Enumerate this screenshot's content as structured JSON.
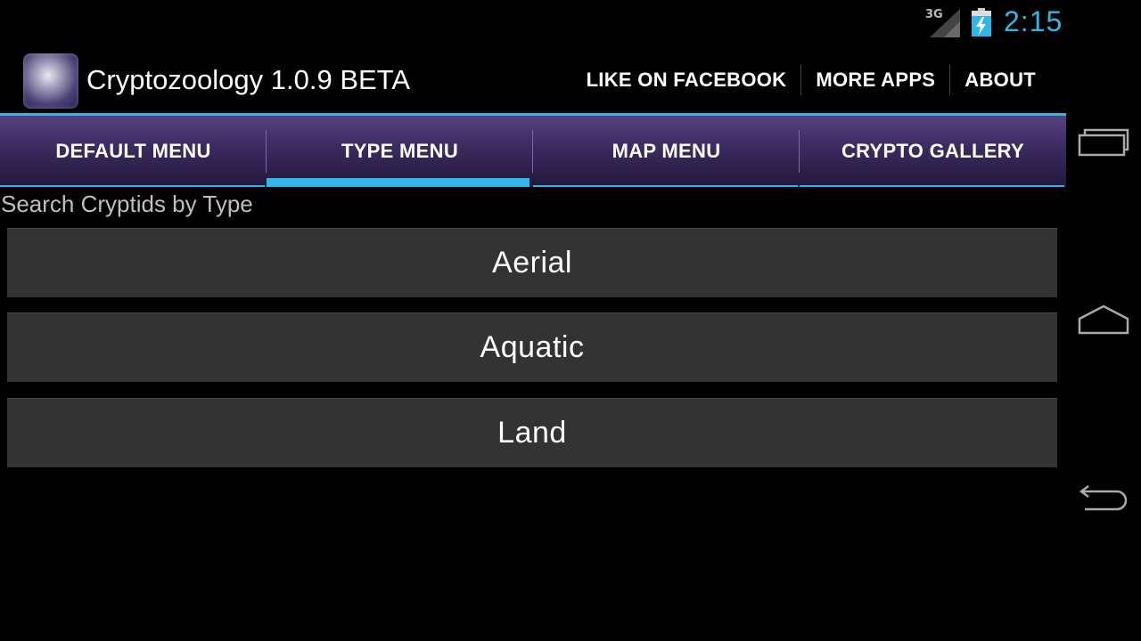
{
  "status_bar": {
    "network": "3G",
    "time": "2:15"
  },
  "action_bar": {
    "title": "Cryptozoology 1.0.9 BETA",
    "actions": [
      "LIKE ON FACEBOOK",
      "MORE APPS",
      "ABOUT"
    ]
  },
  "tabs": [
    {
      "label": "DEFAULT MENU",
      "selected": false
    },
    {
      "label": "TYPE MENU",
      "selected": true
    },
    {
      "label": "MAP MENU",
      "selected": false
    },
    {
      "label": "CRYPTO GALLERY",
      "selected": false
    }
  ],
  "content": {
    "heading": "Search Cryptids by Type",
    "types": [
      "Aerial",
      "Aquatic",
      "Land"
    ]
  },
  "colors": {
    "accent": "#33b5e5",
    "tab_bg": "#3d2d63",
    "button_bg": "#333333"
  },
  "navigation": {
    "icons": [
      "recent-apps-icon",
      "home-icon",
      "back-icon"
    ]
  }
}
